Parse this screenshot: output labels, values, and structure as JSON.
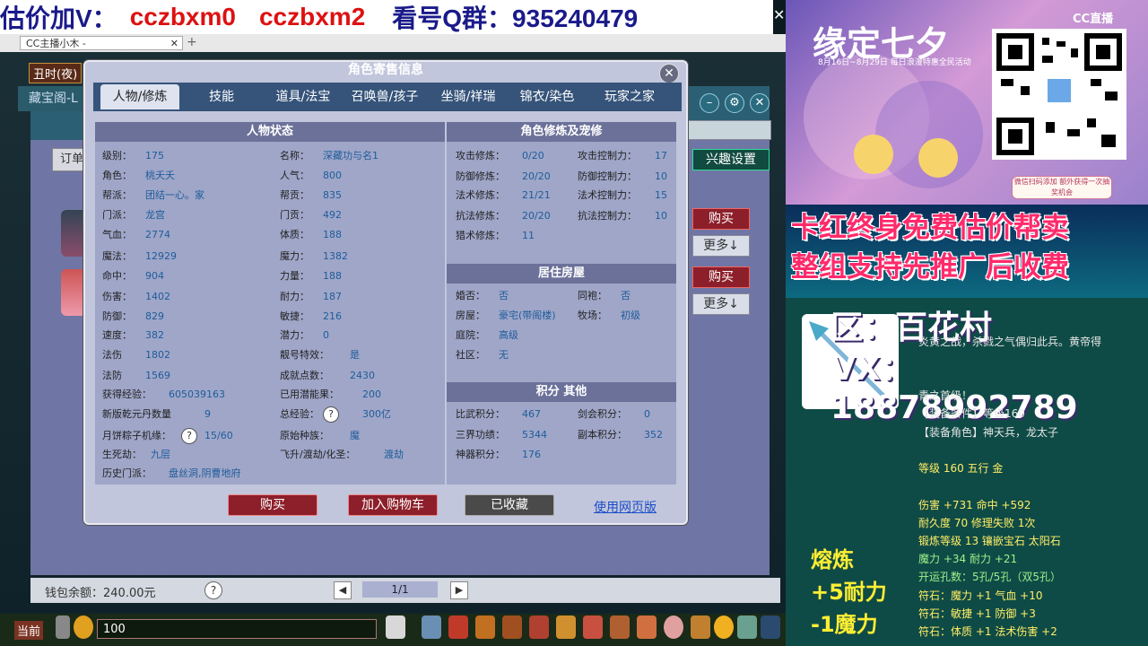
{
  "banner": {
    "left": "估价加V：",
    "part1": "cczbxm0",
    "part2": "cczbxm2",
    "right": "看号Q群：935240479"
  },
  "browser": {
    "tab_title": "CC主播小木 -"
  },
  "game": {
    "time": "丑时(夜)",
    "side_label": "藏宝阁-L",
    "order_btn": "订单",
    "interest_btn": "兴趣设置",
    "buy_label": "购买",
    "more_label": "更多↓",
    "wallet": "钱包余额：240.00元",
    "page": "1/1",
    "chat_label": "当前",
    "chat_value": "100"
  },
  "dialog": {
    "title": "角色寄售信息",
    "tabs": [
      "人物/修炼",
      "技能",
      "道具/法宝",
      "召唤兽/孩子",
      "坐骑/祥瑞",
      "锦衣/染色",
      "玩家之家"
    ],
    "status_head": "人物状态",
    "status_left": [
      {
        "label": "级别：",
        "value": "175"
      },
      {
        "label": "角色：",
        "value": "桃夭夭"
      },
      {
        "label": "帮派：",
        "value": "团结一心。家"
      },
      {
        "label": "门派：",
        "value": "龙宫"
      },
      {
        "label": "气血：",
        "value": "2774"
      },
      {
        "label": "魔法：",
        "value": "12929"
      },
      {
        "label": "命中：",
        "value": "904"
      },
      {
        "label": "伤害：",
        "value": "1402"
      },
      {
        "label": "防御：",
        "value": "829"
      },
      {
        "label": "速度：",
        "value": "382"
      },
      {
        "label": "法伤",
        "value": "1802"
      },
      {
        "label": "法防",
        "value": "1569"
      }
    ],
    "status_right": [
      {
        "label": "名称：",
        "value": "深藏功与名1"
      },
      {
        "label": "人气：",
        "value": "800"
      },
      {
        "label": "帮贡：",
        "value": "835"
      },
      {
        "label": "门贡：",
        "value": "492"
      },
      {
        "label": "体质：",
        "value": "188"
      },
      {
        "label": "魔力：",
        "value": "1382"
      },
      {
        "label": "力量：",
        "value": "188"
      },
      {
        "label": "耐力：",
        "value": "187"
      },
      {
        "label": "敏捷：",
        "value": "216"
      },
      {
        "label": "潜力：",
        "value": "0"
      },
      {
        "label": "靓号特效：",
        "value": "是"
      },
      {
        "label": "成就点数：",
        "value": "2430"
      }
    ],
    "status_extra": [
      {
        "label": "获得经验：",
        "value": "605039163",
        "label2": "已用潜能果：",
        "value2": "200"
      },
      {
        "label": "新版乾元丹数量",
        "value": "9",
        "label2": "总经验：",
        "value2": "300亿"
      },
      {
        "label": "月饼粽子机缘：",
        "value": "15/60",
        "label2": "原始种族：",
        "value2": "魔"
      },
      {
        "label": "生死劫：",
        "value": "九层",
        "label2": "飞升/渡劫/化圣：",
        "value2": "渡劫"
      },
      {
        "label": "历史门派：",
        "value": "盘丝洞,阴曹地府"
      }
    ],
    "cultivation_head": "角色修炼及宠修",
    "cultivation": [
      {
        "label": "攻击修炼：",
        "value": "0/20",
        "label2": "攻击控制力：",
        "value2": "17"
      },
      {
        "label": "防御修炼：",
        "value": "20/20",
        "label2": "防御控制力：",
        "value2": "10"
      },
      {
        "label": "法术修炼：",
        "value": "21/21",
        "label2": "法术控制力：",
        "value2": "15"
      },
      {
        "label": "抗法修炼：",
        "value": "20/20",
        "label2": "抗法控制力：",
        "value2": "10"
      },
      {
        "label": "猎术修炼：",
        "value": "11",
        "label2": "",
        "value2": ""
      }
    ],
    "house_head": "居住房屋",
    "house": [
      {
        "label": "婚否：",
        "value": "否",
        "label2": "同袍：",
        "value2": "否"
      },
      {
        "label": "房屋：",
        "value": "豪宅(带阁楼)",
        "label2": "牧场：",
        "value2": "初级"
      },
      {
        "label": "庭院：",
        "value": "高级",
        "label2": "",
        "value2": ""
      },
      {
        "label": "社区：",
        "value": "无",
        "label2": "",
        "value2": ""
      }
    ],
    "score_head": "积分 其他",
    "score": [
      {
        "label": "比武积分：",
        "value": "467",
        "label2": "剑会积分：",
        "value2": "0"
      },
      {
        "label": "三界功绩：",
        "value": "5344",
        "label2": "副本积分：",
        "value2": "352"
      },
      {
        "label": "神器积分：",
        "value": "176",
        "label2": "",
        "value2": ""
      }
    ],
    "buy_btn": "购买",
    "cart_btn": "加入购物车",
    "fav_btn": "已收藏",
    "web_link": "使用网页版"
  },
  "stream": {
    "event_title": "缘定七夕",
    "event_sub": "8月16日~8月29日 每日浪漫特惠全民活动",
    "cc_logo": "CC直播",
    "promo_box": "微信扫码添加 额外获得一次抽奖机会",
    "promo1": "卡红终身免费估价帮卖",
    "promo2": "整组支持先推广后收费",
    "area": "区：百花村",
    "vx": "VX：18878992789",
    "desc_lines": [
      {
        "text": "炎黄之战，杀戮之气偶归此兵。黄帝得",
        "style": "w"
      },
      {
        "text": "青之首级！",
        "style": "w"
      },
      {
        "text": "【装备条件】等级160",
        "style": "w"
      },
      {
        "text": "【装备角色】神天兵，龙太子",
        "style": "w"
      },
      {
        "text": "等级 160 五行 金",
        "style": "y"
      },
      {
        "text": "伤害 +731 命中 +592",
        "style": "y"
      },
      {
        "text": "耐久度 70 修理失败 1次",
        "style": "y"
      },
      {
        "text": "锻炼等级 13 镶嵌宝石 太阳石",
        "style": "y"
      },
      {
        "text": "魔力 +34 耐力 +21",
        "style": "g"
      },
      {
        "text": "开运孔数：5孔/5孔（双5孔）",
        "style": "g"
      },
      {
        "text": "符石：魔力 +1 气血 +10",
        "style": "y"
      },
      {
        "text": "符石：敏捷 +1 防御 +3",
        "style": "y"
      },
      {
        "text": "符石：体质 +1 法术伤害 +2",
        "style": "y"
      }
    ],
    "smelt_title": "熔炼",
    "smelt_1": "+5耐力",
    "smelt_2": "-1魔力"
  }
}
